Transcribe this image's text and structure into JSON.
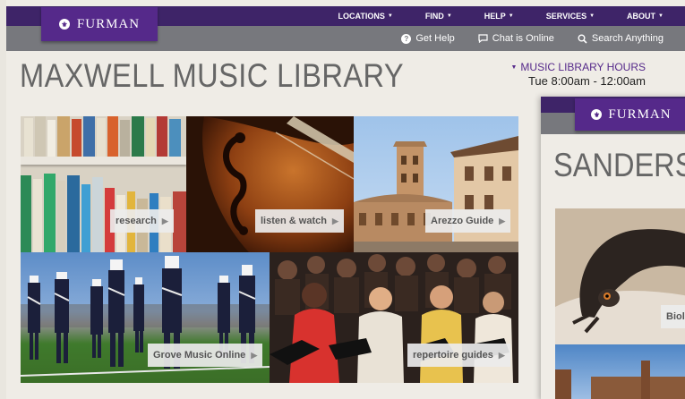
{
  "brand": {
    "name": "FURMAN",
    "seal_glyph": "⚜"
  },
  "top_nav": [
    {
      "label": "LOCATIONS"
    },
    {
      "label": "FIND"
    },
    {
      "label": "HELP"
    },
    {
      "label": "SERVICES"
    },
    {
      "label": "ABOUT"
    }
  ],
  "utility_nav": [
    {
      "icon": "help-icon",
      "label": "Get Help"
    },
    {
      "icon": "chat-icon",
      "label": "Chat is Online"
    },
    {
      "icon": "search-icon",
      "label": "Search Anything"
    }
  ],
  "page_title": "MAXWELL MUSIC LIBRARY",
  "hours": {
    "label": "MUSIC LIBRARY HOURS",
    "value": "Tue 8:00am - 12:00am"
  },
  "tiles": [
    {
      "label": "research"
    },
    {
      "label": "listen & watch"
    },
    {
      "label": "Arezzo Guide"
    },
    {
      "label": "Grove Music Online"
    },
    {
      "label": "repertoire guides"
    }
  ],
  "second_page": {
    "brand": "FURMAN",
    "title": "SANDERS",
    "tile_label": "Biolo"
  },
  "colors": {
    "purple_dark": "#3e2468",
    "purple_brand": "#55298a",
    "gray_bar": "#77787d"
  }
}
